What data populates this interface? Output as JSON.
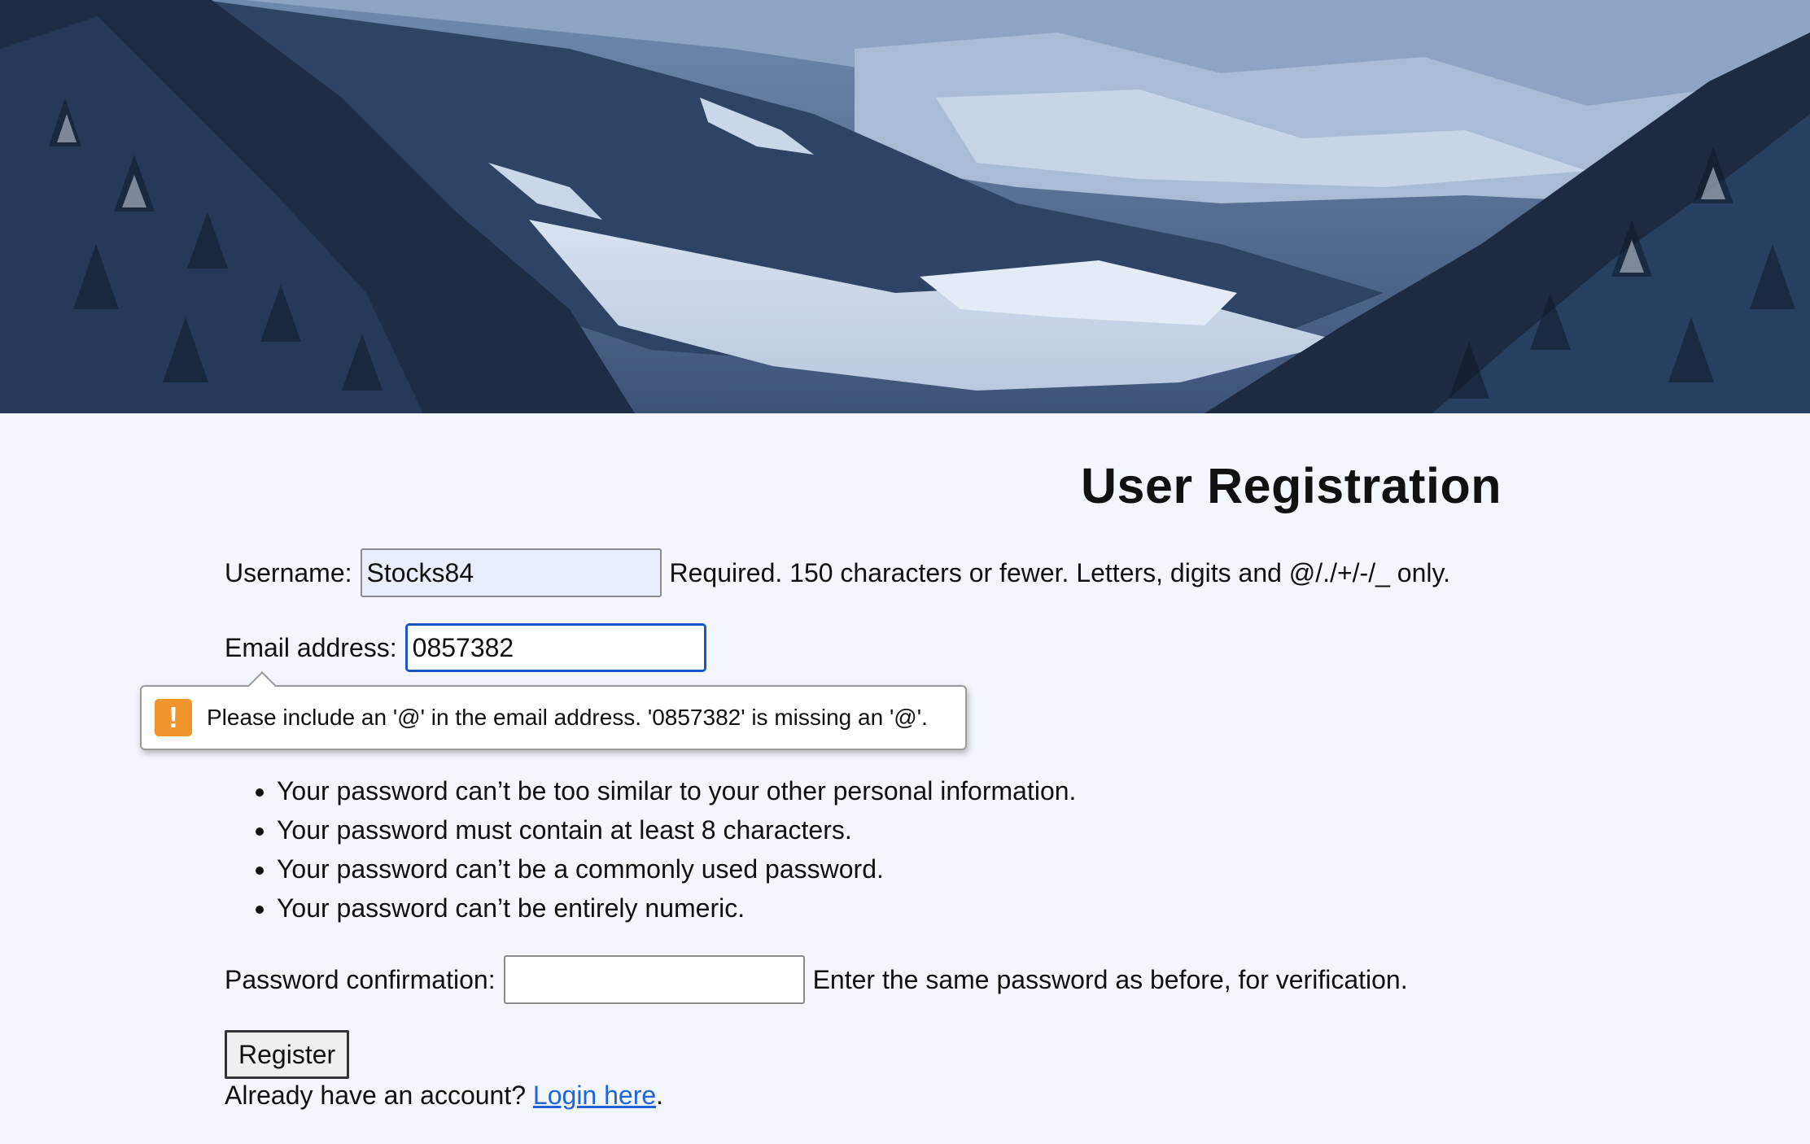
{
  "page": {
    "title": "User Registration"
  },
  "form": {
    "username_label": "Username:",
    "username_value": "Stocks84",
    "username_help": "Required. 150 characters or fewer. Letters, digits and @/./+/-/_ only.",
    "email_label": "Email address:",
    "email_value": "0857382",
    "validation_message": "Please include an '@' in the email address. '0857382' is missing an '@'.",
    "password_rules": [
      "Your password can’t be too similar to your other personal information.",
      "Your password must contain at least 8 characters.",
      "Your password can’t be a commonly used password.",
      "Your password can’t be entirely numeric."
    ],
    "password_confirm_label": "Password confirmation:",
    "password_confirm_value": "",
    "password_confirm_help": "Enter the same password as before, for verification.",
    "submit_label": "Register"
  },
  "footer": {
    "prompt": "Already have an account?",
    "login_link": "Login here",
    "suffix": "."
  },
  "colors": {
    "background": "#f3f6fd",
    "accent": "#1a56c4",
    "link": "#1f64d8",
    "warning": "#f0952c"
  },
  "icons": {
    "warning": "exclamation-warning-icon"
  }
}
